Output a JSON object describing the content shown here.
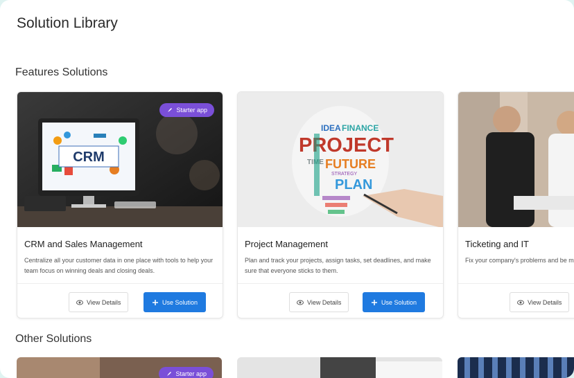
{
  "page": {
    "title": "Solution Library"
  },
  "sections": {
    "featured_title": "Features Solutions",
    "other_title": "Other Solutions"
  },
  "featured": [
    {
      "name": "CRM and Sales Management",
      "description": "Centralize all your customer data in one place with tools to help your team focus on winning deals and closing deals.",
      "badge": "Starter app",
      "image_text": "CRM",
      "view_label": "View Details",
      "use_label": "Use Solution"
    },
    {
      "name": "Project Management",
      "description": "Plan and track your projects, assign tasks, set deadlines, and make sure that everyone sticks to them.",
      "image_words": [
        "IDEA",
        "FINANCE",
        "PROJECT",
        "TIME",
        "FUTURE",
        "STRATEGY",
        "PLAN"
      ],
      "view_label": "View Details",
      "use_label": "Use Solution"
    },
    {
      "name": "Ticketing and IT",
      "description": "Fix your company's problems and be more productive across your IT",
      "view_label": "View Details"
    }
  ],
  "other": [
    {
      "badge": "Starter app"
    }
  ],
  "colors": {
    "primary_button": "#1f7ae0",
    "badge": "#7a4fd8",
    "background": "#dff3f1"
  }
}
